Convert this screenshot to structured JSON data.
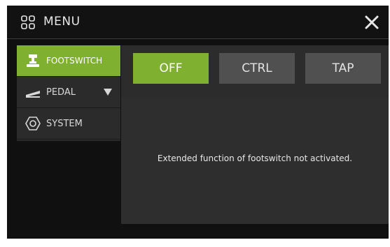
{
  "header": {
    "title": "MENU",
    "menu_icon": "grid-icon",
    "close_icon": "close-icon"
  },
  "sidebar": {
    "items": [
      {
        "label": "FOOTSWITCH",
        "icon": "footswitch-icon",
        "active": true
      },
      {
        "label": "PEDAL",
        "icon": "pedal-icon",
        "active": false,
        "has_dropdown": true
      },
      {
        "label": "SYSTEM",
        "icon": "system-icon",
        "active": false
      }
    ]
  },
  "mode_tabs": [
    {
      "label": "OFF",
      "active": true
    },
    {
      "label": "CTRL",
      "active": false
    },
    {
      "label": "TAP",
      "active": false
    }
  ],
  "panel": {
    "message": "Extended function of footswitch not activated."
  },
  "colors": {
    "accent": "#7fb02f",
    "background": "#101010",
    "sidebar": "#2b2b2b",
    "tab_inactive": "#505050",
    "panel": "#2e2e2e"
  }
}
